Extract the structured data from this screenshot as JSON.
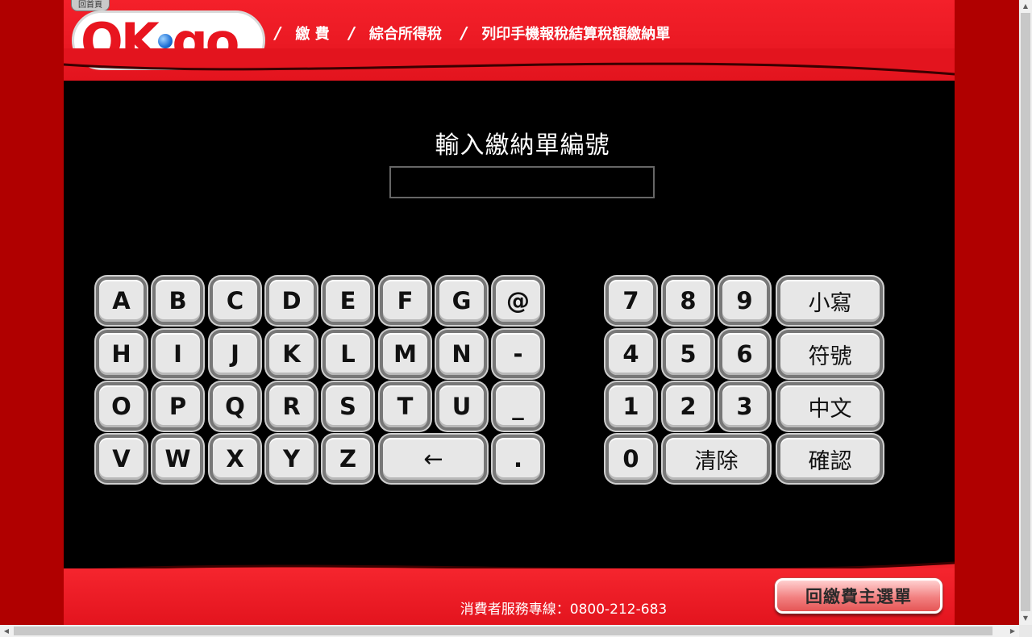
{
  "header": {
    "home_label": "回首頁",
    "logo_text": "OK go",
    "breadcrumb": [
      "繳 費",
      "綜合所得稅",
      "列印手機報稅結算稅額繳納單"
    ]
  },
  "main": {
    "title": "輸入繳納單編號",
    "input_value": ""
  },
  "keyboard": {
    "letters": [
      "A",
      "B",
      "C",
      "D",
      "E",
      "F",
      "G",
      "@",
      "H",
      "I",
      "J",
      "K",
      "L",
      "M",
      "N",
      "-",
      "O",
      "P",
      "Q",
      "R",
      "S",
      "T",
      "U",
      "_",
      "V",
      "W",
      "X",
      "Y",
      "Z"
    ],
    "backspace": "←",
    "dot": ".",
    "digits": [
      "7",
      "8",
      "9",
      "4",
      "5",
      "6",
      "1",
      "2",
      "3",
      "0"
    ],
    "lowercase": "小寫",
    "symbols": "符號",
    "chinese": "中文",
    "clear": "清除",
    "confirm": "確認"
  },
  "footer": {
    "hotline": "消費者服務專線：0800-212-683",
    "menu_button": "回繳費主選單"
  },
  "colors": {
    "brand_red": "#e8151f",
    "background": "#000000",
    "side_red": "#b00000"
  }
}
